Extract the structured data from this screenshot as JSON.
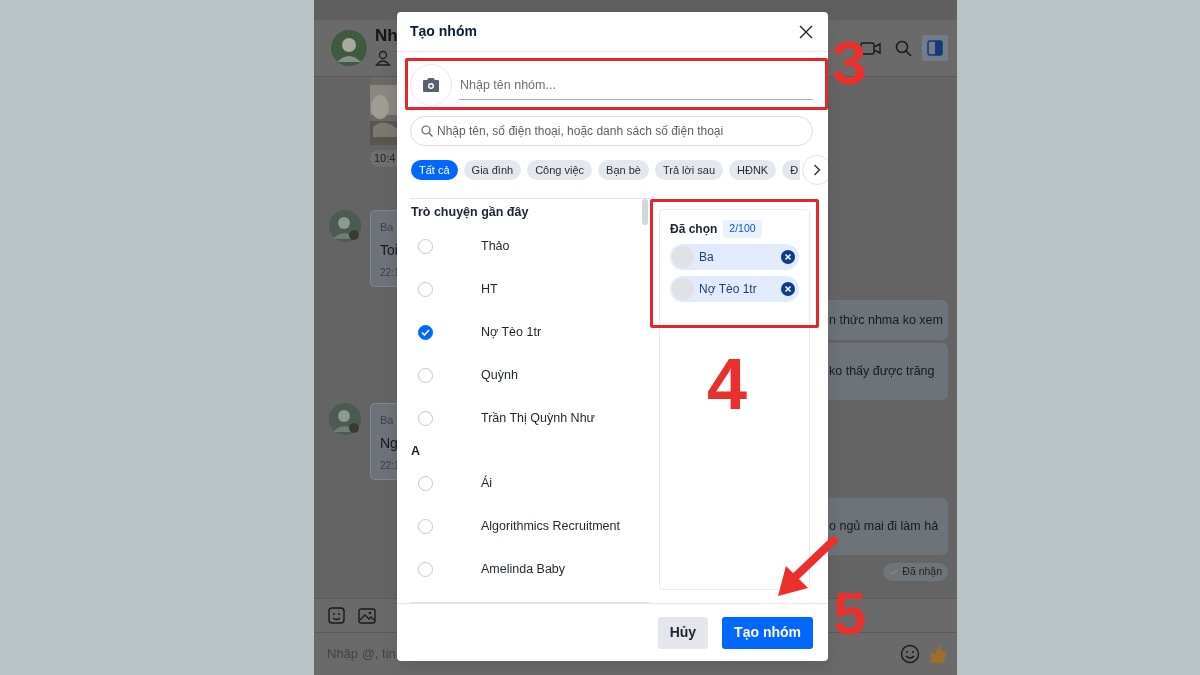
{
  "background_chat": {
    "contact_name": "Nh",
    "image_time": "10:4",
    "messages_left": [
      {
        "sender": "Ba",
        "text": "Toi",
        "time": "22:1"
      },
      {
        "sender": "Ba",
        "text": "Ng",
        "time": "22:1"
      }
    ],
    "messages_right": [
      {
        "text": "n thức nhma ko xem"
      },
      {
        "text": "ko thấy được trăng"
      },
      {
        "text": "o ngủ mai đi làm hả"
      }
    ],
    "status": "Đã nhận",
    "input_placeholder": "Nhập @, tin"
  },
  "dialog": {
    "title": "Tạo nhóm",
    "group_name": {
      "placeholder": "Nhập tên nhóm..."
    },
    "search": {
      "placeholder": "Nhập tên, số điện thoại, hoặc danh sách số điện thoại"
    },
    "filters": [
      {
        "label": "Tất cả",
        "selected": true
      },
      {
        "label": "Gia đình",
        "selected": false
      },
      {
        "label": "Công việc",
        "selected": false
      },
      {
        "label": "Bạn bè",
        "selected": false
      },
      {
        "label": "Trả lời sau",
        "selected": false
      },
      {
        "label": "HĐNK",
        "selected": false
      },
      {
        "label": "Đ",
        "selected": false
      }
    ],
    "sections": [
      {
        "title": "Trò chuyện gần đây",
        "contacts": [
          {
            "name": "Thảo",
            "checked": false
          },
          {
            "name": "HT",
            "checked": false
          },
          {
            "name": "Nợ Tèo 1tr",
            "checked": true
          },
          {
            "name": "Quỳnh",
            "checked": false
          },
          {
            "name": "Trần Thị Quỳnh Như",
            "checked": false
          }
        ]
      },
      {
        "title": "A",
        "contacts": [
          {
            "name": "Ái",
            "checked": false
          },
          {
            "name": "Algorithmics Recruitment",
            "checked": false
          },
          {
            "name": "Amelinda Baby",
            "checked": false
          }
        ]
      }
    ],
    "selected_panel": {
      "title": "Đã chọn",
      "count": "2/100",
      "members": [
        {
          "name": "Ba"
        },
        {
          "name": "Nợ Tèo 1tr"
        }
      ]
    },
    "buttons": [
      {
        "label": "Hủy",
        "kind": "secondary"
      },
      {
        "label": "Tạo nhóm",
        "kind": "primary"
      }
    ]
  },
  "annotations": [
    {
      "label": "3"
    },
    {
      "label": "4"
    },
    {
      "label": "5"
    }
  ]
}
